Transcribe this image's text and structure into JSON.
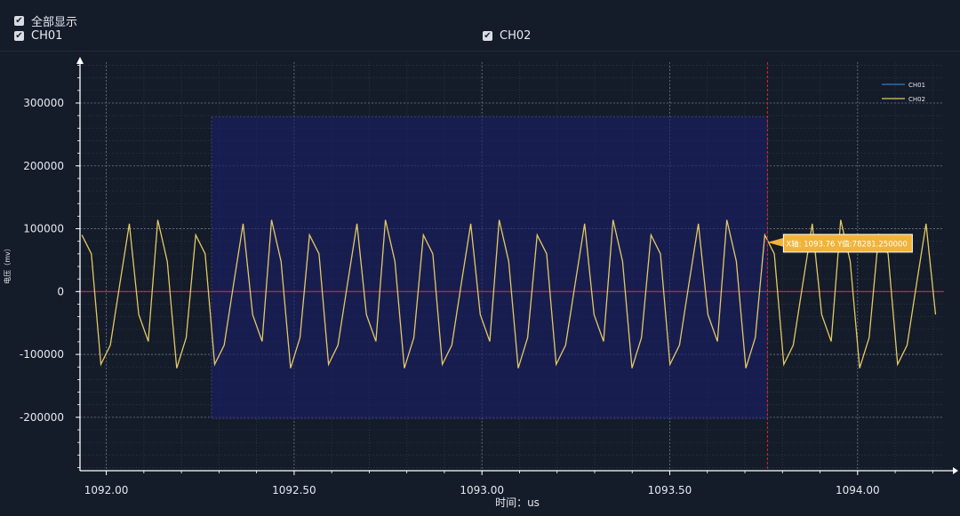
{
  "controls": {
    "show_all": {
      "label": "全部显示",
      "checked": true
    },
    "channels": [
      {
        "label": "CH01",
        "checked": true
      },
      {
        "label": "CH02",
        "checked": true
      }
    ]
  },
  "chart_data": {
    "type": "line",
    "title": "",
    "xlabel": "时间：us",
    "ylabel": "电压（mv）",
    "xlim": [
      1091.93,
      1094.23
    ],
    "ylim": [
      -285000,
      365000
    ],
    "x_ticks": [
      1092.0,
      1092.5,
      1093.0,
      1093.5,
      1094.0
    ],
    "x_tick_labels": [
      "1092.00",
      "1092.50",
      "1093.00",
      "1093.50",
      "1094.00"
    ],
    "y_ticks": [
      300000,
      200000,
      100000,
      0,
      -100000,
      -200000
    ],
    "y_tick_labels": [
      "300000",
      "200000",
      "100000",
      "0",
      "-100000",
      "-200000"
    ],
    "grid": true,
    "legend_position": "top-right",
    "series": [
      {
        "name": "CH01",
        "color": "#2f7fd0",
        "values": [
          0,
          0
        ]
      },
      {
        "name": "CH02",
        "color": "#e3c964",
        "amplitude_pos": 120000,
        "amplitude_neg": -122000,
        "period_us": 0.101
      }
    ],
    "selection_region": {
      "x": [
        1092.28,
        1093.76
      ],
      "y": [
        -202000,
        278000
      ],
      "color": "#1a1f66"
    },
    "cursor": {
      "x": 1093.76,
      "color": "#d42a2a"
    },
    "tooltip": {
      "text": "X轴: 1093.76 Y值:78281.250000",
      "x": 1093.76,
      "y": 78281.25,
      "color": "#f2b33a"
    },
    "zero_line_color": "#cc2a2a"
  }
}
